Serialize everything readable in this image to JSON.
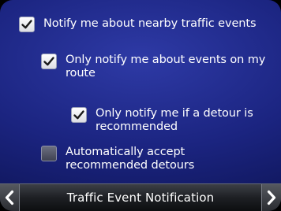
{
  "screen": {
    "title": "Traffic Event Notification"
  },
  "options": [
    {
      "label": "Notify me about nearby traffic events",
      "checked": true
    },
    {
      "label": "Only notify me about events on my route",
      "checked": true
    },
    {
      "label": "Only notify me if a detour is recommended",
      "checked": true
    },
    {
      "label": "Automatically accept recommended detours",
      "checked": false
    }
  ],
  "icons": {
    "prev": "chevron-left-icon",
    "next": "chevron-right-icon",
    "check": "checkmark-icon"
  },
  "colors": {
    "background": "#1b2480",
    "text": "#ffffff",
    "bar": "#1e2024"
  }
}
